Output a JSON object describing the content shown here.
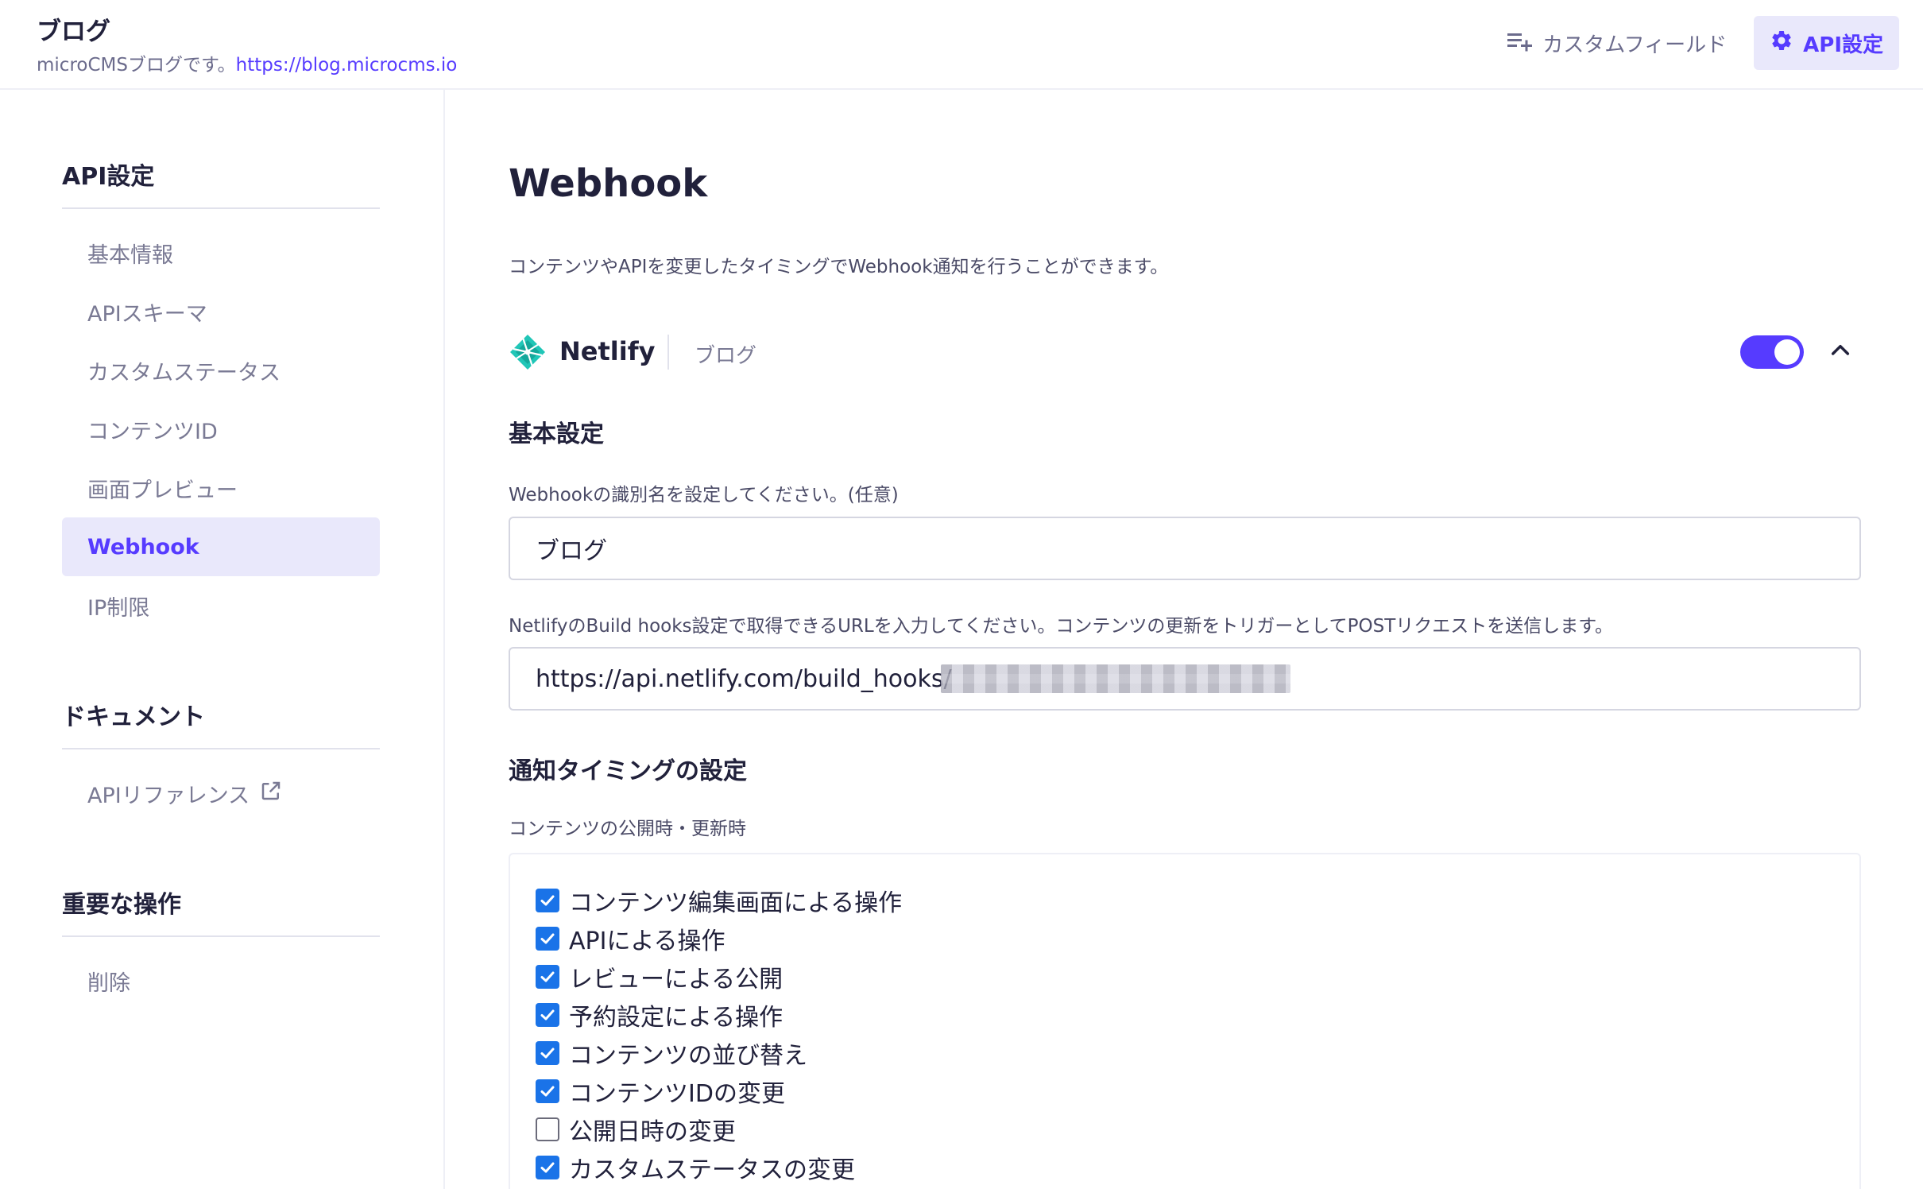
{
  "header": {
    "title": "ブログ",
    "description": "microCMSブログです。",
    "link": "https://blog.microcms.io",
    "custom_field_label": "カスタムフィールド",
    "api_settings_label": "API設定"
  },
  "sidebar": {
    "sections": [
      {
        "heading": "API設定",
        "items": [
          "基本情報",
          "APIスキーマ",
          "カスタムステータス",
          "コンテンツID",
          "画面プレビュー",
          "Webhook",
          "IP制限"
        ],
        "active": "Webhook"
      },
      {
        "heading": "ドキュメント",
        "items": [
          "APIリファレンス"
        ]
      },
      {
        "heading": "重要な操作",
        "items": [
          "削除"
        ]
      }
    ]
  },
  "main": {
    "title": "Webhook",
    "description": "コンテンツやAPIを変更したタイミングでWebhook通知を行うことができます。",
    "service": {
      "name": "Netlify",
      "label": "ブログ",
      "enabled": true
    },
    "basic": {
      "heading": "基本設定",
      "name_label": "Webhookの識別名を設定してください。(任意)",
      "name_value": "ブログ",
      "url_label": "NetlifyのBuild hooks設定で取得できるURLを入力してください。コンテンツの更新をトリガーとしてPOSTリクエストを送信します。",
      "url_value": "https://api.netlify.com/build_hooks/"
    },
    "timing": {
      "heading": "通知タイミングの設定",
      "group_label": "コンテンツの公開時・更新時",
      "options": [
        {
          "label": "コンテンツ編集画面による操作",
          "checked": true
        },
        {
          "label": "APIによる操作",
          "checked": true
        },
        {
          "label": "レビューによる公開",
          "checked": true
        },
        {
          "label": "予約設定による操作",
          "checked": true
        },
        {
          "label": "コンテンツの並び替え",
          "checked": true
        },
        {
          "label": "コンテンツIDの変更",
          "checked": true
        },
        {
          "label": "公開日時の変更",
          "checked": false
        },
        {
          "label": "カスタムステータスの変更",
          "checked": true
        }
      ]
    }
  },
  "colors": {
    "accent": "#563bff",
    "accent_bg": "#e9e8fb",
    "checkbox": "#1a73e8",
    "netlify": "#20c6b7"
  }
}
